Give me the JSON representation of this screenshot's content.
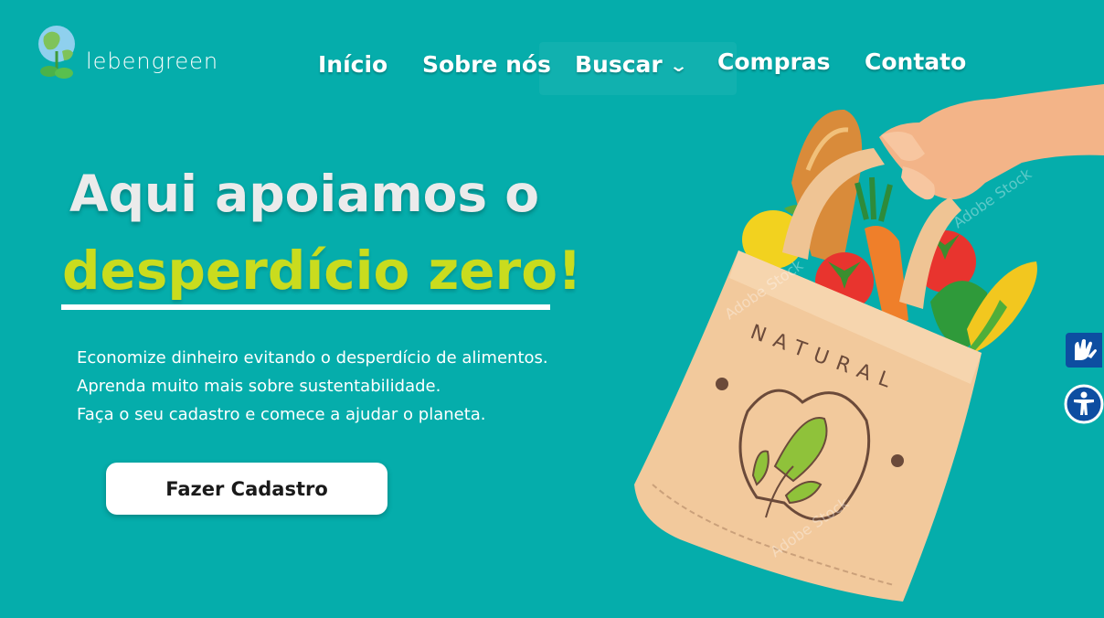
{
  "brand": {
    "name": "lebengreen"
  },
  "nav": {
    "items": [
      {
        "label": "Início"
      },
      {
        "label": "Sobre nós"
      },
      {
        "label": "Buscar"
      },
      {
        "label": "Compras"
      },
      {
        "label": "Contato"
      }
    ]
  },
  "hero": {
    "headline_line1": "Aqui apoiamos o",
    "headline_line2": "desperdício zero!",
    "description": [
      "Economize dinheiro evitando o desperdício de alimentos.",
      "Aprenda muito mais sobre sustentabilidade.",
      "Faça o seu cadastro e comece a ajudar o planeta."
    ],
    "cta_label": "Fazer Cadastro"
  },
  "illustration": {
    "bag_label": "NATURAL",
    "watermark": "Adobe Stock"
  },
  "colors": {
    "background": "#05adab",
    "accent": "#c9dc1e",
    "headline": "#ebebeb",
    "libras_button": "#0d4ea1"
  },
  "icons": {
    "libras": "sign-language-icon",
    "accessibility": "accessibility-icon",
    "dropdown": "chevron-down-icon"
  }
}
